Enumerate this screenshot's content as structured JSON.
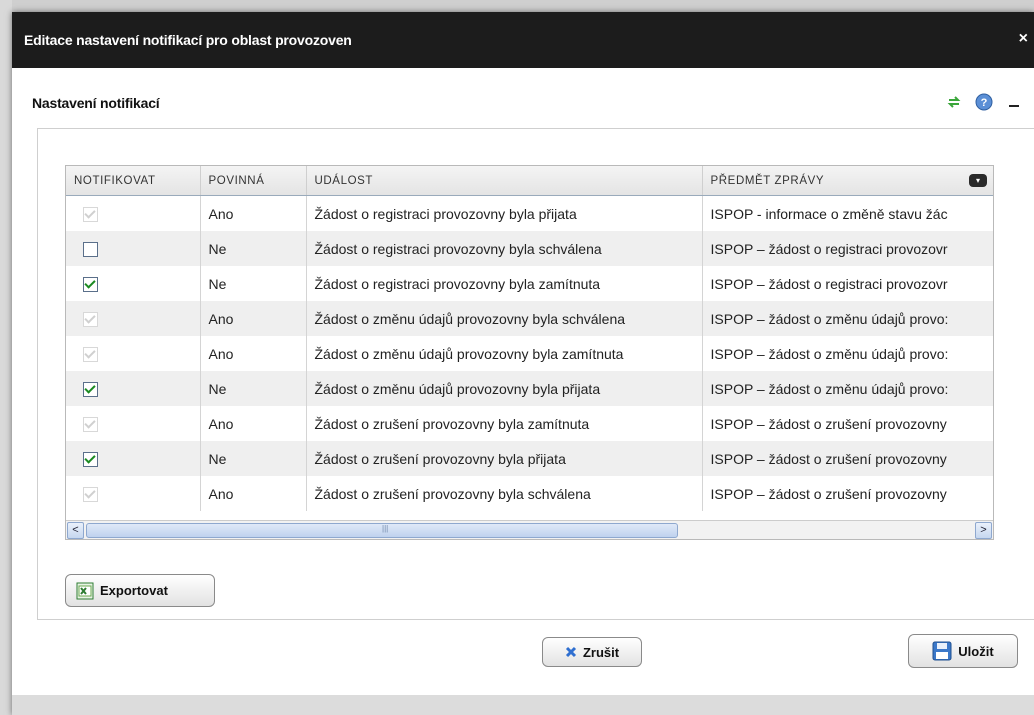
{
  "dialog": {
    "title": "Editace nastavení notifikací pro oblast provozoven",
    "close_label": "×"
  },
  "section": {
    "title": "Nastavení notifikací"
  },
  "grid": {
    "columns": [
      "NOTIFIKOVAT",
      "POVINNÁ",
      "UDÁLOST",
      "PŘEDMĚT ZPRÁVY"
    ],
    "rows": [
      {
        "notify": true,
        "disabled": true,
        "required": "Ano",
        "event": "Žádost o registraci provozovny byla přijata",
        "subject": "ISPOP - informace o změně stavu žác"
      },
      {
        "notify": false,
        "disabled": false,
        "required": "Ne",
        "event": "Žádost o registraci provozovny byla schválena",
        "subject": "ISPOP – žádost o registraci provozovr"
      },
      {
        "notify": true,
        "disabled": false,
        "required": "Ne",
        "event": "Žádost o registraci provozovny byla zamítnuta",
        "subject": "ISPOP – žádost o registraci provozovr"
      },
      {
        "notify": true,
        "disabled": true,
        "required": "Ano",
        "event": "Žádost o změnu údajů provozovny byla schválena",
        "subject": "ISPOP – žádost o změnu údajů provo:"
      },
      {
        "notify": true,
        "disabled": true,
        "required": "Ano",
        "event": "Žádost o změnu údajů provozovny byla zamítnuta",
        "subject": "ISPOP – žádost o změnu údajů provo:"
      },
      {
        "notify": true,
        "disabled": false,
        "required": "Ne",
        "event": "Žádost o změnu údajů provozovny byla přijata",
        "subject": "ISPOP – žádost o změnu údajů provo:"
      },
      {
        "notify": true,
        "disabled": true,
        "required": "Ano",
        "event": "Žádost o zrušení provozovny byla zamítnuta",
        "subject": "ISPOP – žádost o zrušení provozovny"
      },
      {
        "notify": true,
        "disabled": false,
        "required": "Ne",
        "event": "Žádost o zrušení provozovny byla přijata",
        "subject": "ISPOP – žádost o zrušení provozovny"
      },
      {
        "notify": true,
        "disabled": true,
        "required": "Ano",
        "event": "Žádost o zrušení provozovny byla schválena",
        "subject": "ISPOP – žádost o zrušení provozovny"
      }
    ],
    "scroll_left": "<",
    "scroll_right": ">",
    "scroll_grip": "|||"
  },
  "buttons": {
    "export": "Exportovat",
    "cancel": "Zrušit",
    "save": "Uložit"
  },
  "icons": {
    "refresh": "refresh-icon",
    "help": "help-icon",
    "minimize": "minimize-icon"
  }
}
